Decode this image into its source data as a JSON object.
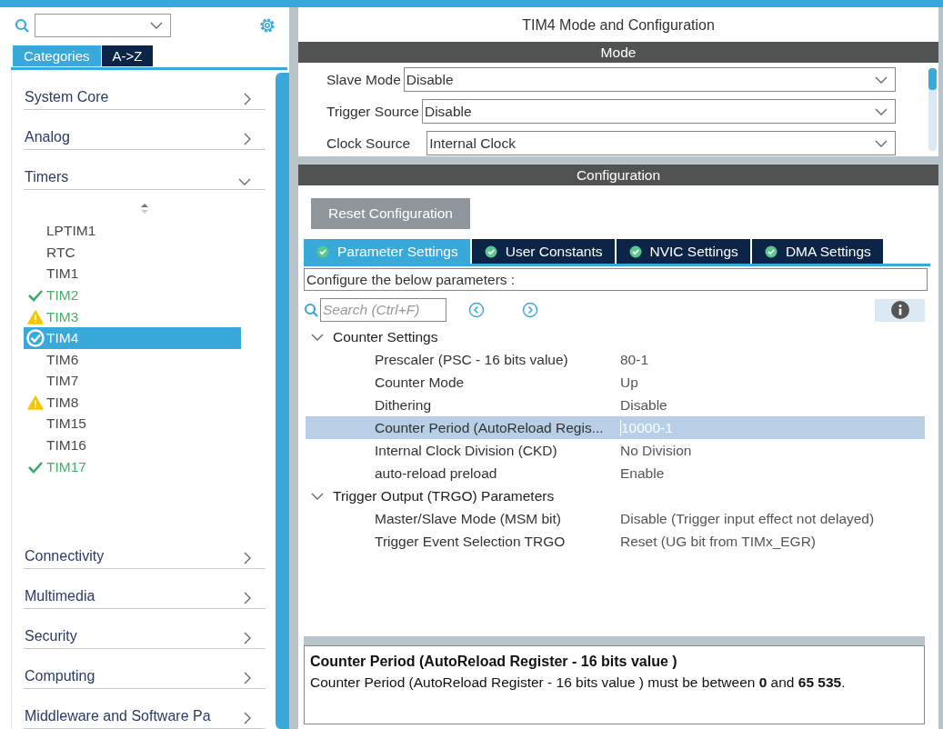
{
  "sidebar": {
    "tabs": [
      {
        "label": "Categories",
        "selected": true
      },
      {
        "label": "A->Z",
        "selected": false
      }
    ],
    "categories": [
      {
        "label": "System Core",
        "expanded": false
      },
      {
        "label": "Analog",
        "expanded": false
      },
      {
        "label": "Timers",
        "expanded": true,
        "items": [
          {
            "label": "LPTIM1",
            "ok": false,
            "warning": false,
            "configured": false,
            "selected": false
          },
          {
            "label": "RTC",
            "ok": false,
            "warning": false,
            "configured": false,
            "selected": false
          },
          {
            "label": "TIM1",
            "ok": false,
            "warning": false,
            "configured": false,
            "selected": false
          },
          {
            "label": "TIM2",
            "ok": true,
            "warning": false,
            "configured": true,
            "selected": false
          },
          {
            "label": "TIM3",
            "ok": false,
            "warning": true,
            "configured": true,
            "selected": false
          },
          {
            "label": "TIM4",
            "ok": true,
            "warning": false,
            "configured": true,
            "selected": true
          },
          {
            "label": "TIM6",
            "ok": false,
            "warning": false,
            "configured": false,
            "selected": false
          },
          {
            "label": "TIM7",
            "ok": false,
            "warning": false,
            "configured": false,
            "selected": false
          },
          {
            "label": "TIM8",
            "ok": false,
            "warning": true,
            "configured": false,
            "selected": false
          },
          {
            "label": "TIM15",
            "ok": false,
            "warning": false,
            "configured": false,
            "selected": false
          },
          {
            "label": "TIM16",
            "ok": false,
            "warning": false,
            "configured": false,
            "selected": false
          },
          {
            "label": "TIM17",
            "ok": true,
            "warning": false,
            "configured": true,
            "selected": false
          }
        ]
      },
      {
        "label": "Connectivity",
        "expanded": false
      },
      {
        "label": "Multimedia",
        "expanded": false
      },
      {
        "label": "Security",
        "expanded": false
      },
      {
        "label": "Computing",
        "expanded": false
      },
      {
        "label": "Middleware and Software Pa",
        "expanded": false
      }
    ]
  },
  "main": {
    "title": "TIM4 Mode and Configuration",
    "mode": {
      "header": "Mode",
      "fields": [
        {
          "label": "Slave Mode",
          "value": "Disable"
        },
        {
          "label": "Trigger Source",
          "value": "Disable"
        },
        {
          "label": "Clock Source",
          "value": "Internal Clock"
        }
      ]
    },
    "configuration": {
      "header": "Configuration",
      "reset_button": "Reset Configuration",
      "tabs": [
        {
          "label": "Parameter Settings",
          "selected": true
        },
        {
          "label": "User Constants",
          "selected": false
        },
        {
          "label": "NVIC Settings",
          "selected": false
        },
        {
          "label": "DMA Settings",
          "selected": false
        }
      ],
      "hint": "Configure the below parameters :",
      "search": {
        "placeholder": "Search (Ctrl+F)"
      },
      "groups": [
        {
          "label": "Counter Settings",
          "expanded": true,
          "params": [
            {
              "name": "Prescaler (PSC - 16 bits value)",
              "value": "80-1",
              "selected": false
            },
            {
              "name": "Counter Mode",
              "value": "Up",
              "selected": false
            },
            {
              "name": "Dithering",
              "value": "Disable",
              "selected": false
            },
            {
              "name": "Counter Period (AutoReload Regis...",
              "value": "10000-1",
              "selected": true
            },
            {
              "name": "Internal Clock Division (CKD)",
              "value": "No Division",
              "selected": false
            },
            {
              "name": "auto-reload preload",
              "value": "Enable",
              "selected": false
            }
          ]
        },
        {
          "label": "Trigger Output (TRGO) Parameters",
          "expanded": true,
          "params": [
            {
              "name": "Master/Slave Mode (MSM bit)",
              "value": "Disable (Trigger input effect not delayed)",
              "selected": false
            },
            {
              "name": "Trigger Event Selection TRGO",
              "value": "Reset (UG bit from TIMx_EGR)",
              "selected": false
            }
          ]
        }
      ],
      "description": {
        "title": "Counter Period (AutoReload Register - 16 bits value )",
        "text": "Counter Period (AutoReload Register - 16 bits value ) must be between **0** and **65 535**."
      }
    }
  }
}
